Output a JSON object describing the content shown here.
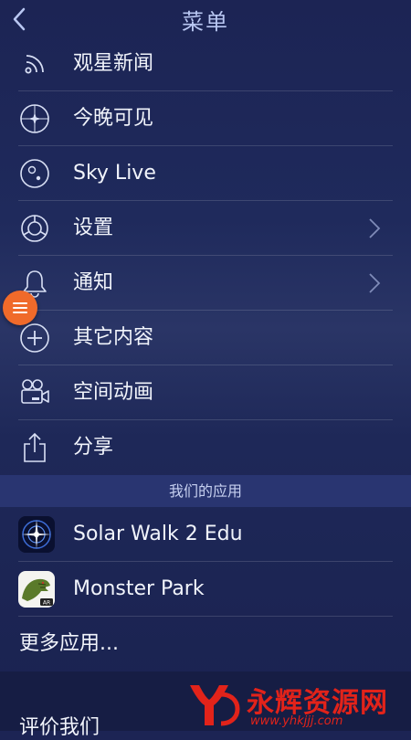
{
  "header": {
    "title": "菜单"
  },
  "menu": {
    "items": [
      {
        "label": "观星新闻",
        "icon": "rss-icon"
      },
      {
        "label": "今晚可见",
        "icon": "compass-icon"
      },
      {
        "label": "Sky Live",
        "icon": "moon-phase-icon"
      },
      {
        "label": "设置",
        "icon": "settings-icon"
      },
      {
        "label": "通知",
        "icon": "bell-icon"
      },
      {
        "label": "其它内容",
        "icon": "plus-circle-icon"
      },
      {
        "label": "空间动画",
        "icon": "video-camera-icon"
      },
      {
        "label": "分享",
        "icon": "share-icon"
      }
    ]
  },
  "section": {
    "apps_title": "我们的应用"
  },
  "apps": [
    {
      "label": "Solar Walk 2 Edu"
    },
    {
      "label": "Monster Park"
    }
  ],
  "more_apps": "更多应用...",
  "rate_us": "评价我们",
  "watermark": {
    "text": "永辉资源网",
    "url": "www.yhkjjj.com"
  },
  "colors": {
    "accent": "#f06a2a",
    "background": "#1f2a5c",
    "watermark": "#e2231a"
  }
}
